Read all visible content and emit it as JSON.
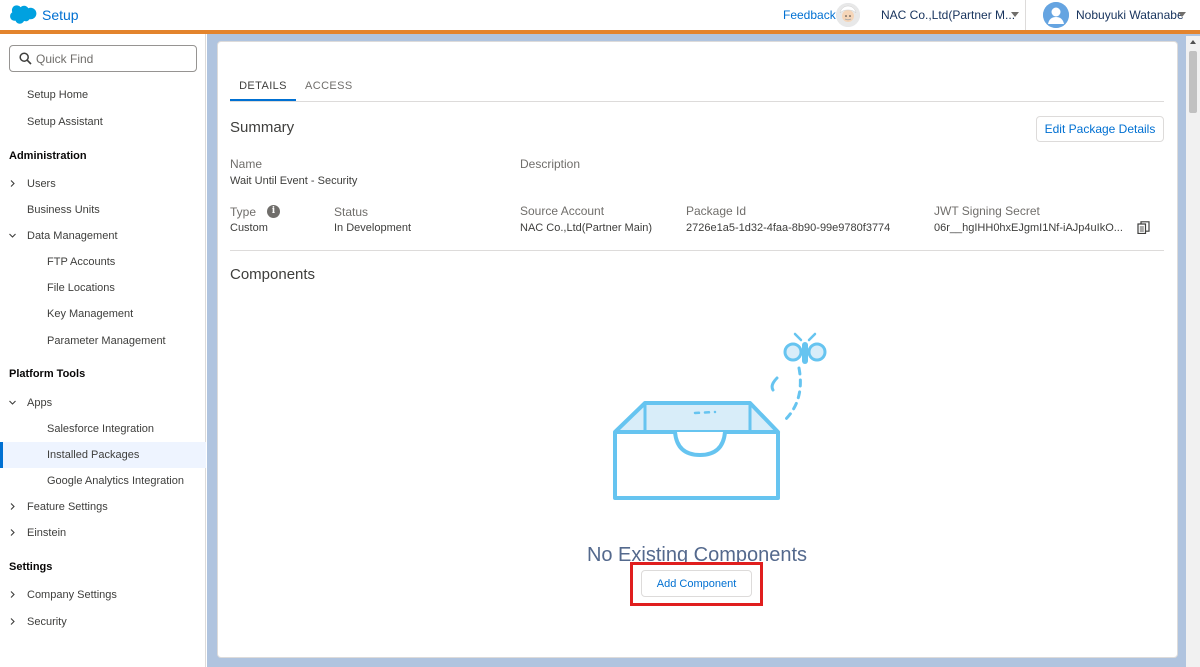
{
  "header": {
    "app_title": "Setup",
    "feedback_link": "Feedback",
    "org_name": "NAC Co.,Ltd(Partner M...",
    "user_name": "Nobuyuki Watanabe"
  },
  "sidebar": {
    "quick_find_placeholder": "Quick Find",
    "items": [
      {
        "label": "Setup Home"
      },
      {
        "label": "Setup Assistant"
      },
      {
        "section": "Administration"
      },
      {
        "label": "Users"
      },
      {
        "label": "Business Units"
      },
      {
        "label": "Data Management"
      },
      {
        "label": "FTP Accounts"
      },
      {
        "label": "File Locations"
      },
      {
        "label": "Key Management"
      },
      {
        "label": "Parameter Management"
      },
      {
        "section": "Platform Tools"
      },
      {
        "label": "Apps"
      },
      {
        "label": "Salesforce Integration"
      },
      {
        "label": "Installed Packages"
      },
      {
        "label": "Google Analytics Integration"
      },
      {
        "label": "Feature Settings"
      },
      {
        "label": "Einstein"
      },
      {
        "section": "Settings"
      },
      {
        "label": "Company Settings"
      },
      {
        "label": "Security"
      }
    ]
  },
  "tabs": {
    "details": "DETAILS",
    "access": "ACCESS"
  },
  "summary": {
    "heading": "Summary",
    "edit_button": "Edit Package Details",
    "name_label": "Name",
    "name_value": "Wait Until Event - Security",
    "description_label": "Description",
    "type_label": "Type",
    "type_value": "Custom",
    "status_label": "Status",
    "status_value": "In Development",
    "source_account_label": "Source Account",
    "source_account_value": "NAC Co.,Ltd(Partner Main)",
    "package_id_label": "Package Id",
    "package_id_value": "2726e1a5-1d32-4faa-8b90-99e9780f3774",
    "jwt_label": "JWT Signing Secret",
    "jwt_value": "06r__hgIHH0hxEJgmI1Nf-iAJp4uIkO..."
  },
  "components": {
    "heading": "Components",
    "empty_text": "No Existing Components",
    "add_button": "Add Component"
  },
  "colors": {
    "brand_blue": "#0070d2",
    "header_stripe": "#e3842d",
    "highlight_red": "#e01e1e"
  }
}
